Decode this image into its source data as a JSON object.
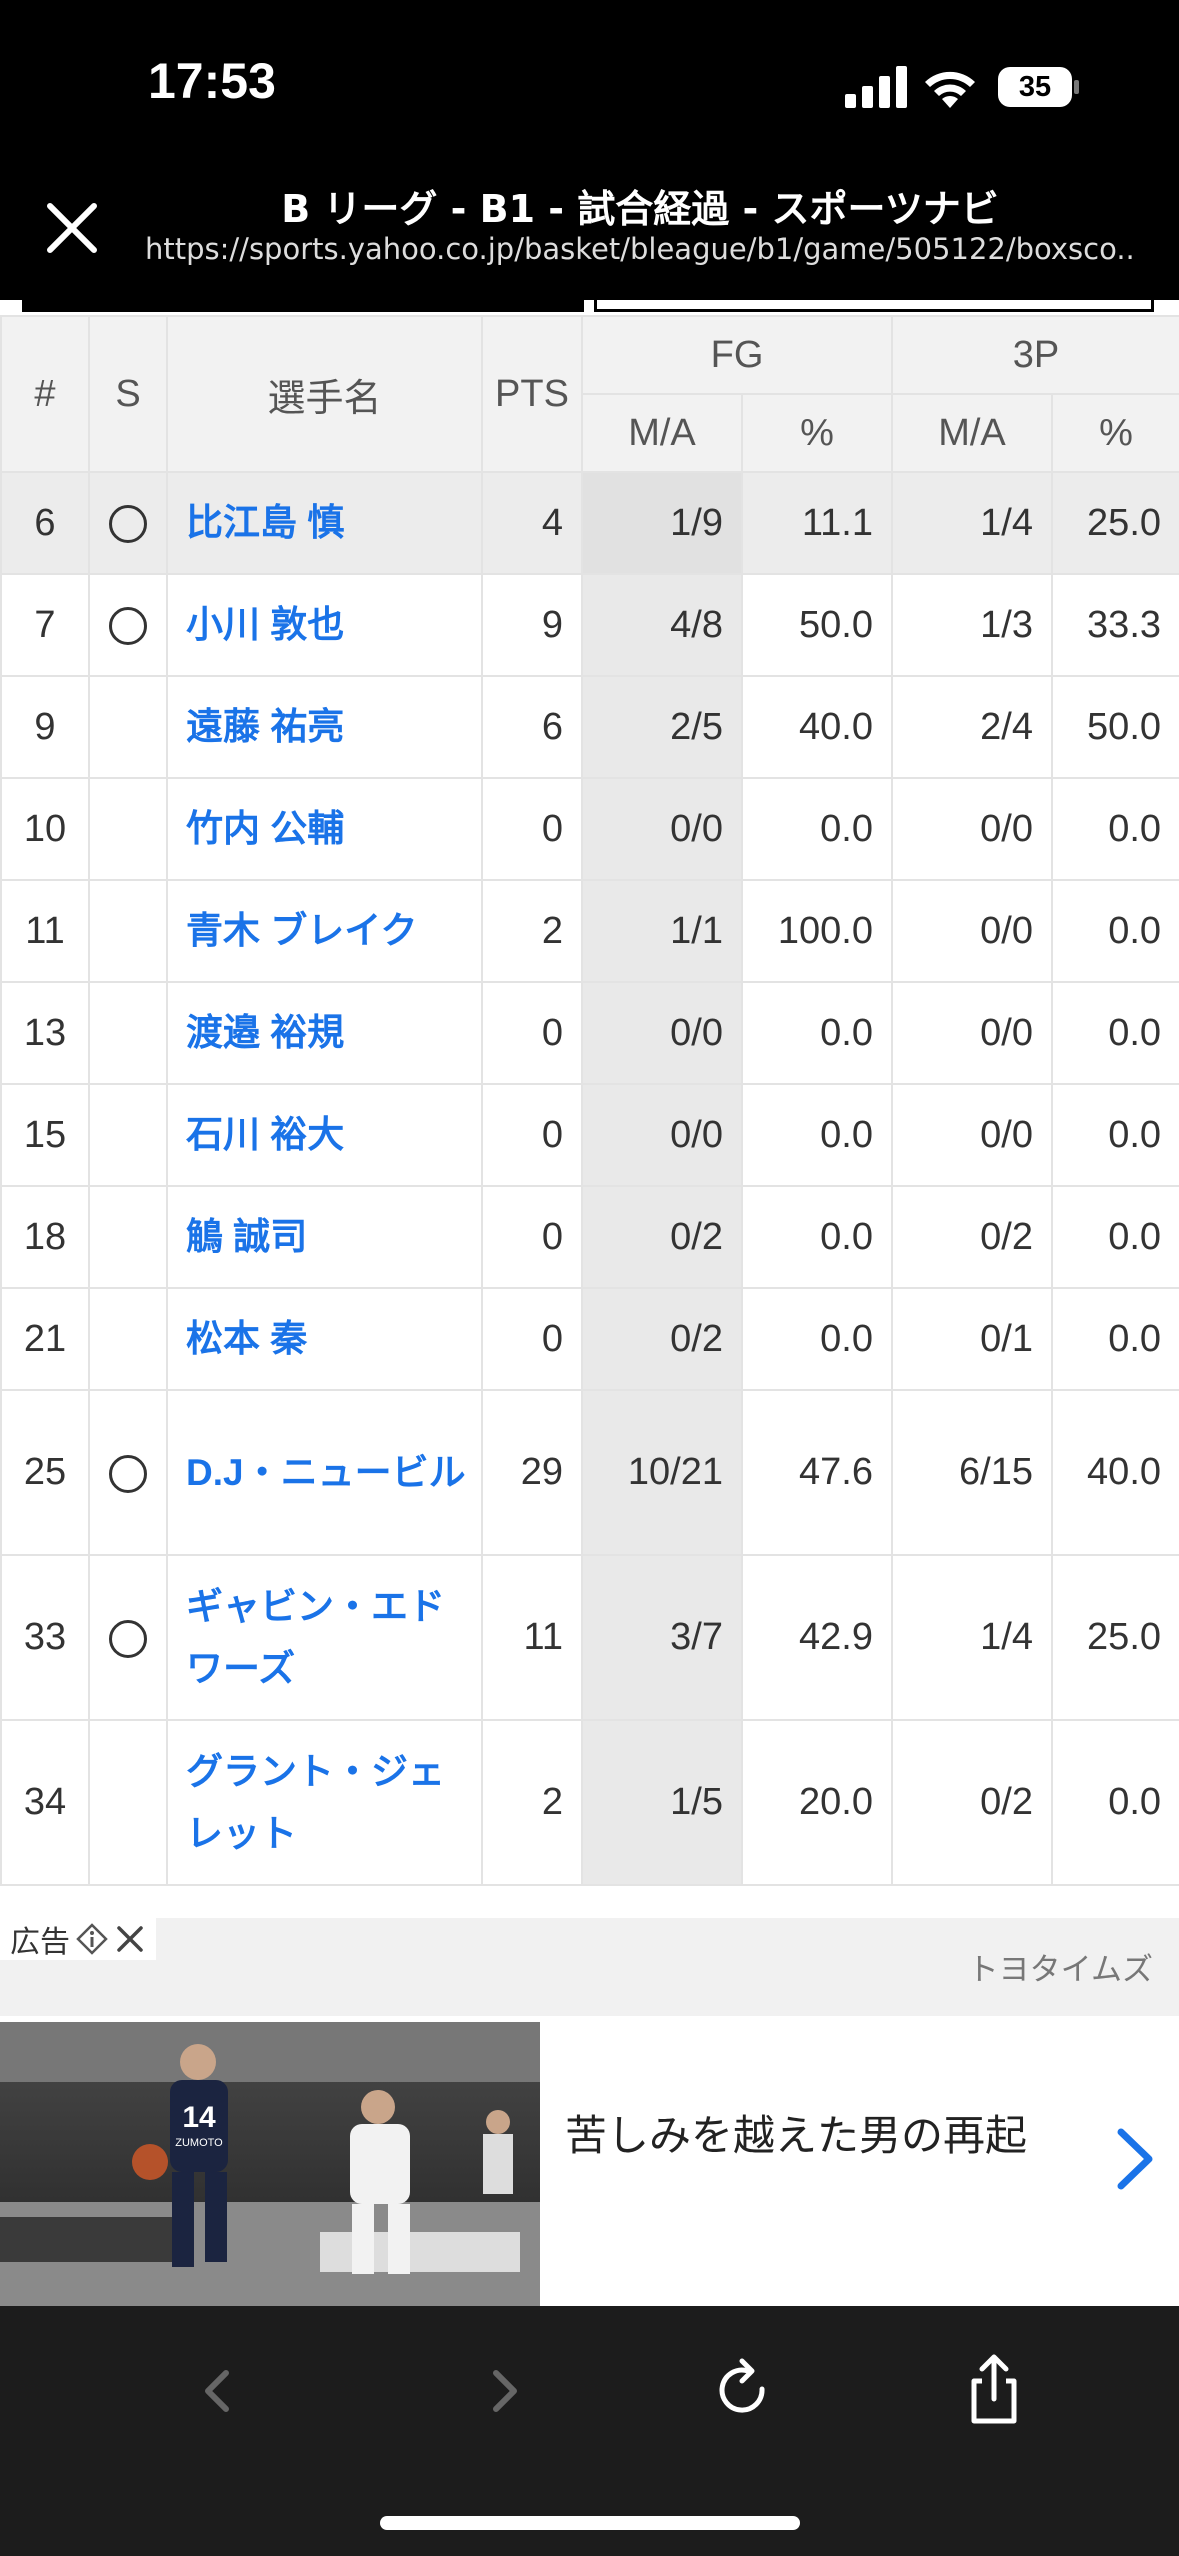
{
  "status_bar": {
    "time": "17:53",
    "battery": "35"
  },
  "browser": {
    "title": "B リーグ - B1 - 試合経過 - スポーツナビ",
    "url": "https://sports.yahoo.co.jp/basket/bleague/b1/game/505122/boxsco..."
  },
  "table": {
    "headers": {
      "number": "#",
      "starter": "S",
      "player": "選手名",
      "pts": "PTS",
      "fg": "FG",
      "threep": "3P",
      "ma": "M/A",
      "pct": "%"
    },
    "rows": [
      {
        "number": "6",
        "starter": true,
        "name": "比江島 慎",
        "pts": "4",
        "fg_ma": "1/9",
        "fg_pct": "11.1",
        "tp_ma": "1/4",
        "tp_pct": "25.0"
      },
      {
        "number": "7",
        "starter": true,
        "name": "小川 敦也",
        "pts": "9",
        "fg_ma": "4/8",
        "fg_pct": "50.0",
        "tp_ma": "1/3",
        "tp_pct": "33.3"
      },
      {
        "number": "9",
        "starter": false,
        "name": "遠藤 祐亮",
        "pts": "6",
        "fg_ma": "2/5",
        "fg_pct": "40.0",
        "tp_ma": "2/4",
        "tp_pct": "50.0"
      },
      {
        "number": "10",
        "starter": false,
        "name": "竹内 公輔",
        "pts": "0",
        "fg_ma": "0/0",
        "fg_pct": "0.0",
        "tp_ma": "0/0",
        "tp_pct": "0.0"
      },
      {
        "number": "11",
        "starter": false,
        "name": "青木 ブレイク",
        "pts": "2",
        "fg_ma": "1/1",
        "fg_pct": "100.0",
        "tp_ma": "0/0",
        "tp_pct": "0.0"
      },
      {
        "number": "13",
        "starter": false,
        "name": "渡邉 裕規",
        "pts": "0",
        "fg_ma": "0/0",
        "fg_pct": "0.0",
        "tp_ma": "0/0",
        "tp_pct": "0.0"
      },
      {
        "number": "15",
        "starter": false,
        "name": "石川 裕大",
        "pts": "0",
        "fg_ma": "0/0",
        "fg_pct": "0.0",
        "tp_ma": "0/0",
        "tp_pct": "0.0"
      },
      {
        "number": "18",
        "starter": false,
        "name": "鵤 誠司",
        "pts": "0",
        "fg_ma": "0/2",
        "fg_pct": "0.0",
        "tp_ma": "0/2",
        "tp_pct": "0.0"
      },
      {
        "number": "21",
        "starter": false,
        "name": "松本 秦",
        "pts": "0",
        "fg_ma": "0/2",
        "fg_pct": "0.0",
        "tp_ma": "0/1",
        "tp_pct": "0.0"
      },
      {
        "number": "25",
        "starter": true,
        "name": "D.J・ニュービル",
        "pts": "29",
        "fg_ma": "10/21",
        "fg_pct": "47.6",
        "tp_ma": "6/15",
        "tp_pct": "40.0"
      },
      {
        "number": "33",
        "starter": true,
        "name": "ギャビン・エドワーズ",
        "pts": "11",
        "fg_ma": "3/7",
        "fg_pct": "42.9",
        "tp_ma": "1/4",
        "tp_pct": "25.0"
      },
      {
        "number": "34",
        "starter": false,
        "name": "グラント・ジェレット",
        "pts": "2",
        "fg_ma": "1/5",
        "fg_pct": "20.0",
        "tp_ma": "0/2",
        "tp_pct": "0.0"
      }
    ]
  },
  "ad": {
    "label": "広告",
    "sponsor": "トヨタイムズ",
    "headline": "苦しみを越えた男の再起",
    "image_jersey_text": "14",
    "image_name_text": "ZUMOTO"
  },
  "colors": {
    "link": "#1a73e8",
    "ad_chevron": "#1a73e8",
    "toolbar": "#1c1c1c"
  }
}
